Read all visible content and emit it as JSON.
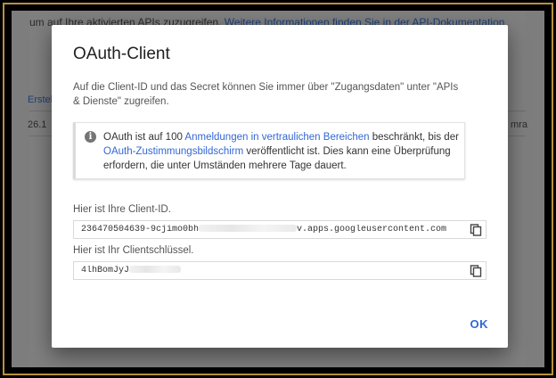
{
  "background": {
    "intro_text": "um auf Ihre aktivierten APIs zuzugreifen.",
    "intro_link": "Weitere Informationen finden Sie in der API-Dokumentation",
    "tab_label": "Erstel",
    "row_number": "26.1",
    "row_right": "mra"
  },
  "dialog": {
    "title": "OAuth-Client",
    "description": "Auf die Client-ID und das Secret können Sie immer über \"Zugangsdaten\" unter \"APIs & Dienste\" zugreifen.",
    "info": {
      "part1": "OAuth ist auf 100 ",
      "link1": "Anmeldungen in vertraulichen Bereichen",
      "part2": " beschränkt, bis der ",
      "link2": "OAuth-Zustimmungsbildschirm",
      "part3": " veröffentlicht ist. Dies kann eine Überprüfung erfordern, die unter Umständen mehrere Tage dauert."
    },
    "client_id_label": "Hier ist Ihre Client-ID.",
    "client_id_prefix": "236470504639-9cjimo0bh",
    "client_id_suffix": "v.apps.googleusercontent.com",
    "secret_label": "Hier ist Ihr Clientschlüssel.",
    "secret_prefix": "4lhBomJyJ",
    "ok_label": "OK"
  },
  "colors": {
    "accent": "#3367d6",
    "frame": "#b8923a"
  }
}
